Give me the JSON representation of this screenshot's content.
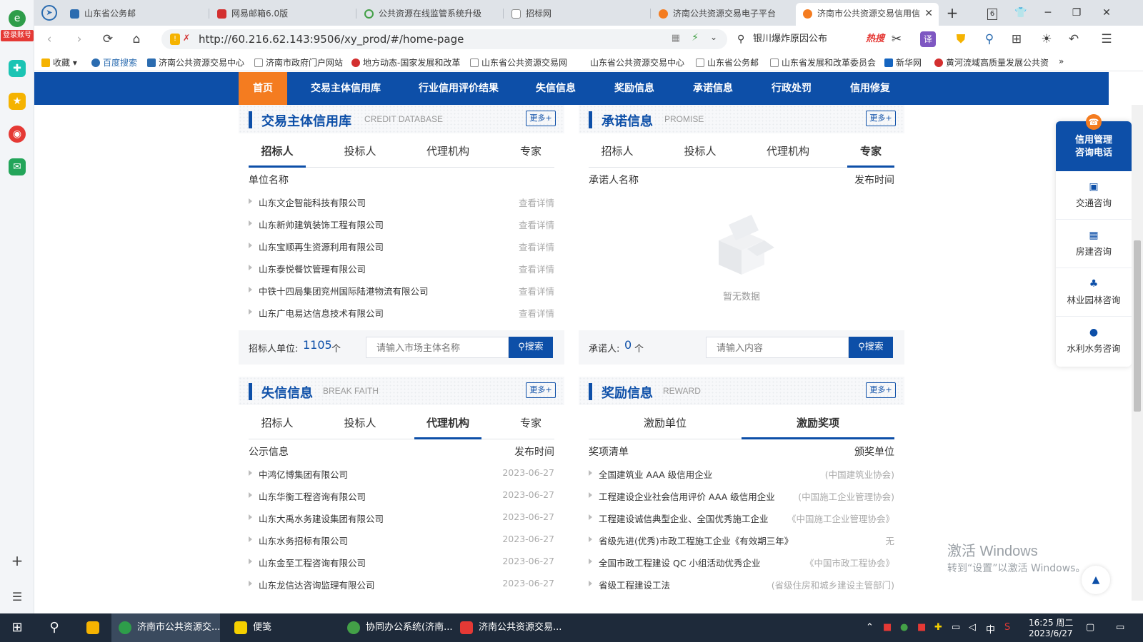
{
  "browser": {
    "login_label": "登录账号",
    "tabs": [
      {
        "label": "山东省公务邮",
        "color": "#2b6cb0"
      },
      {
        "label": "网易邮箱6.0版",
        "color": "#d32f2f"
      },
      {
        "label": "公共资源在线监管系统升级",
        "color": "#43a047"
      },
      {
        "label": "招标网",
        "color": "#9e9e9e"
      },
      {
        "label": "济南公共资源交易电子平台",
        "color": "#f47c20"
      },
      {
        "label": "济南市公共资源交易信用信",
        "color": "#f47c20"
      }
    ],
    "tab_count": "6",
    "url": "http://60.216.62.143:9506/xy_prod/#/home-page",
    "search_text": "银川爆炸原因公布",
    "hot_label": "热搜",
    "bookmarks": [
      "收藏",
      "百度搜索",
      "济南公共资源交易中心",
      "济南市政府门户网站",
      "地方动态-国家发展和改革",
      "山东省公共资源交易网",
      "山东省公共资源交易中心",
      "山东省公务邮",
      "山东省发展和改革委员会",
      "新华网",
      "黄河流域高质量发展公共资"
    ]
  },
  "nav": {
    "items": [
      "首页",
      "交易主体信用库",
      "行业信用评价结果",
      "失信信息",
      "奖励信息",
      "承诺信息",
      "行政处罚",
      "信用修复"
    ]
  },
  "credit_db": {
    "title": "交易主体信用库",
    "title_en": "CREDIT DATABASE",
    "more": "更多+",
    "tabs": [
      "招标人",
      "投标人",
      "代理机构",
      "专家"
    ],
    "col_name": "单位名称",
    "rows": [
      {
        "name": "山东文企智能科技有限公司",
        "action": "查看详情"
      },
      {
        "name": "山东新帅建筑装饰工程有限公司",
        "action": "查看详情"
      },
      {
        "name": "山东宝顺再生资源利用有限公司",
        "action": "查看详情"
      },
      {
        "name": "山东泰悦餐饮管理有限公司",
        "action": "查看详情"
      },
      {
        "name": "中铁十四局集团兖州国际陆港物流有限公司",
        "action": "查看详情"
      },
      {
        "name": "山东广电易达信息技术有限公司",
        "action": "查看详情"
      }
    ],
    "count_label": "招标人单位:",
    "count": "1105",
    "count_unit": "个",
    "search_placeholder": "请输入市场主体名称",
    "search_btn": "搜索"
  },
  "promise": {
    "title": "承诺信息",
    "title_en": "PROMISE",
    "more": "更多+",
    "tabs": [
      "招标人",
      "投标人",
      "代理机构",
      "专家"
    ],
    "col_name": "承诺人名称",
    "col_time": "发布时间",
    "empty": "暂无数据",
    "count_label": "承诺人:",
    "count": "0",
    "count_unit": "个",
    "search_placeholder": "请输入内容",
    "search_btn": "搜索"
  },
  "break_faith": {
    "title": "失信信息",
    "title_en": "BREAK FAITH",
    "more": "更多+",
    "tabs": [
      "招标人",
      "投标人",
      "代理机构",
      "专家"
    ],
    "col_name": "公示信息",
    "col_time": "发布时间",
    "rows": [
      {
        "name": "中鸿亿博集团有限公司",
        "date": "2023-06-27"
      },
      {
        "name": "山东华衡工程咨询有限公司",
        "date": "2023-06-27"
      },
      {
        "name": "山东大禹水务建设集团有限公司",
        "date": "2023-06-27"
      },
      {
        "name": "山东水务招标有限公司",
        "date": "2023-06-27"
      },
      {
        "name": "山东金至工程咨询有限公司",
        "date": "2023-06-27"
      },
      {
        "name": "山东龙信达咨询监理有限公司",
        "date": "2023-06-27"
      }
    ]
  },
  "reward": {
    "title": "奖励信息",
    "title_en": "REWARD",
    "more": "更多+",
    "tabs": [
      "激励单位",
      "激励奖项"
    ],
    "col_name": "奖项清单",
    "col_org": "颁奖单位",
    "rows": [
      {
        "name": "全国建筑业 AAA 级信用企业",
        "org": "(中国建筑业协会)"
      },
      {
        "name": "工程建设企业社会信用评价 AAA 级信用企业",
        "org": "(中国施工企业管理协会)"
      },
      {
        "name": "工程建设诚信典型企业、全国优秀施工企业",
        "org": "《中国施工企业管理协会》"
      },
      {
        "name": "省级先进(优秀)市政工程施工企业《有效期三年》",
        "org": "无"
      },
      {
        "name": "全国市政工程建设 QC 小组活动优秀企业",
        "org": "《中国市政工程协会》"
      },
      {
        "name": "省级工程建设工法",
        "org": "(省级住房和城乡建设主管部门)"
      }
    ]
  },
  "float_panel": {
    "title": "信用管理咨询电话",
    "items": [
      "交通咨询",
      "房建咨询",
      "林业园林咨询",
      "水利水务咨询"
    ]
  },
  "watermark": {
    "line1": "激活 Windows",
    "line2": "转到“设置”以激活 Windows。"
  },
  "taskbar": {
    "items": [
      "济南市公共资源交...",
      "便笺",
      "协同办公系统(济南...",
      "济南公共资源交易..."
    ],
    "ime": "中",
    "time": "16:25 周二",
    "date": "2023/6/27"
  }
}
